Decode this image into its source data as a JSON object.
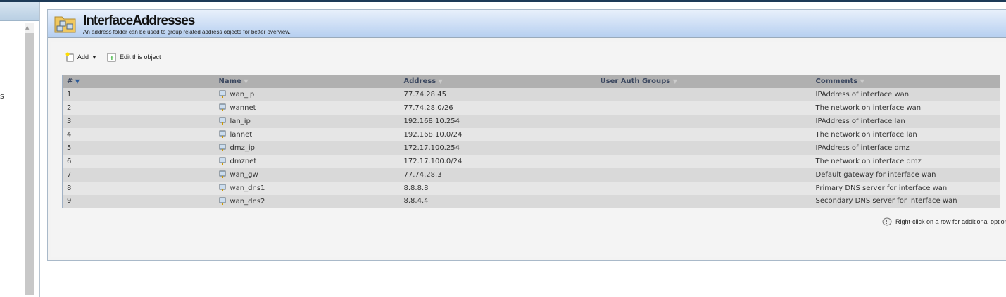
{
  "sidebar": {
    "partial_text": "s"
  },
  "header": {
    "title": "InterfaceAddresses",
    "subtitle": "An address folder can be used to group related address objects for better overview."
  },
  "toolbar": {
    "add_label": "Add",
    "edit_label": "Edit this object"
  },
  "table": {
    "columns": [
      "#",
      "Name",
      "Address",
      "User Auth Groups",
      "Comments"
    ],
    "rows": [
      {
        "n": "1",
        "name": "wan_ip",
        "address": "77.74.28.45",
        "groups": "",
        "comment": "IPAddress of interface wan"
      },
      {
        "n": "2",
        "name": "wannet",
        "address": "77.74.28.0/26",
        "groups": "",
        "comment": "The network on interface wan"
      },
      {
        "n": "3",
        "name": "lan_ip",
        "address": "192.168.10.254",
        "groups": "",
        "comment": "IPAddress of interface lan"
      },
      {
        "n": "4",
        "name": "lannet",
        "address": "192.168.10.0/24",
        "groups": "",
        "comment": "The network on interface lan"
      },
      {
        "n": "5",
        "name": "dmz_ip",
        "address": "172.17.100.254",
        "groups": "",
        "comment": "IPAddress of interface dmz"
      },
      {
        "n": "6",
        "name": "dmznet",
        "address": "172.17.100.0/24",
        "groups": "",
        "comment": "The network on interface dmz"
      },
      {
        "n": "7",
        "name": "wan_gw",
        "address": "77.74.28.3",
        "groups": "",
        "comment": "Default gateway for interface wan"
      },
      {
        "n": "8",
        "name": "wan_dns1",
        "address": "8.8.8.8",
        "groups": "",
        "comment": "Primary DNS server for interface wan"
      },
      {
        "n": "9",
        "name": "wan_dns2",
        "address": "8.8.4.4",
        "groups": "",
        "comment": "Secondary DNS server for interface wan"
      }
    ]
  },
  "hint": "Right-click on a row for additional options"
}
